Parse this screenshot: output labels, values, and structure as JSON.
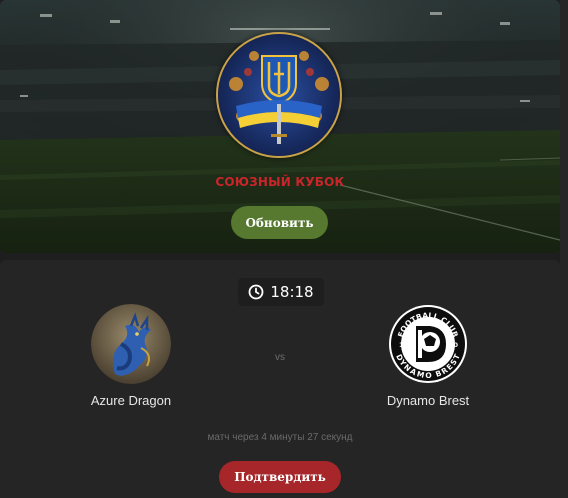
{
  "header": {
    "cup_title": "СОЮЗНЫЙ КУБОК",
    "refresh_label": "Обновить",
    "accent_color": "#56782f",
    "title_color": "#c9252b"
  },
  "match": {
    "time": "18:18",
    "home_team": {
      "name": "Azure Dragon",
      "logo": "azure-dragon-logo"
    },
    "away_team": {
      "name": "Dynamo Brest",
      "logo": "dynamo-brest-logo"
    },
    "vs_label": "vs",
    "countdown": "матч через 4 минуты 27 секунд",
    "confirm_label": "Подтвердить",
    "confirm_color": "#a7262a"
  },
  "icons": {
    "clock": "clock-icon",
    "emblem": "ukraine-trident-emblem"
  }
}
